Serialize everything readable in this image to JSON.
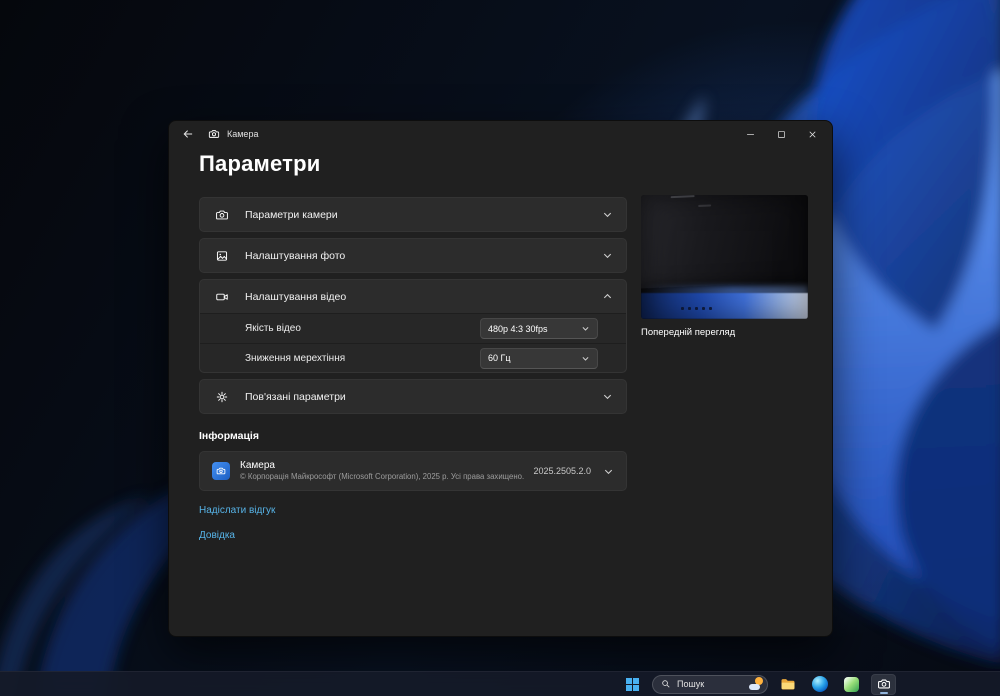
{
  "app": {
    "titlebar": {
      "title": "Камера"
    },
    "page_title": "Параметри",
    "sections": [
      {
        "label": "Параметри камери",
        "icon": "camera-icon",
        "expanded": false
      },
      {
        "label": "Налаштування фото",
        "icon": "photo-icon",
        "expanded": false
      },
      {
        "label": "Налаштування відео",
        "icon": "video-icon",
        "expanded": true
      },
      {
        "label": "Пов'язані параметри",
        "icon": "gear-icon",
        "expanded": false
      }
    ],
    "video": {
      "quality_label": "Якість відео",
      "quality_value": "480p 4:3 30fps",
      "flicker_label": "Зниження мерехтіння",
      "flicker_value": "60 Гц"
    },
    "about": {
      "header": "Інформація",
      "name": "Камера",
      "copyright": "© Корпорація Майкрософт (Microsoft Corporation), 2025 р. Усі права захищено.",
      "version": "2025.2505.2.0"
    },
    "links": {
      "feedback": "Надіслати відгук",
      "help": "Довідка"
    },
    "preview": {
      "label": "Попередній перегляд"
    }
  },
  "taskbar": {
    "search_label": "Пошук"
  },
  "colors": {
    "accent": "#4cc2ff",
    "link": "#57b4e8",
    "window_bg": "#202020",
    "card_bg": "#2c2c2c",
    "taskbar_bg": "#141a28",
    "bloom_blue": "#2f6fe8"
  }
}
